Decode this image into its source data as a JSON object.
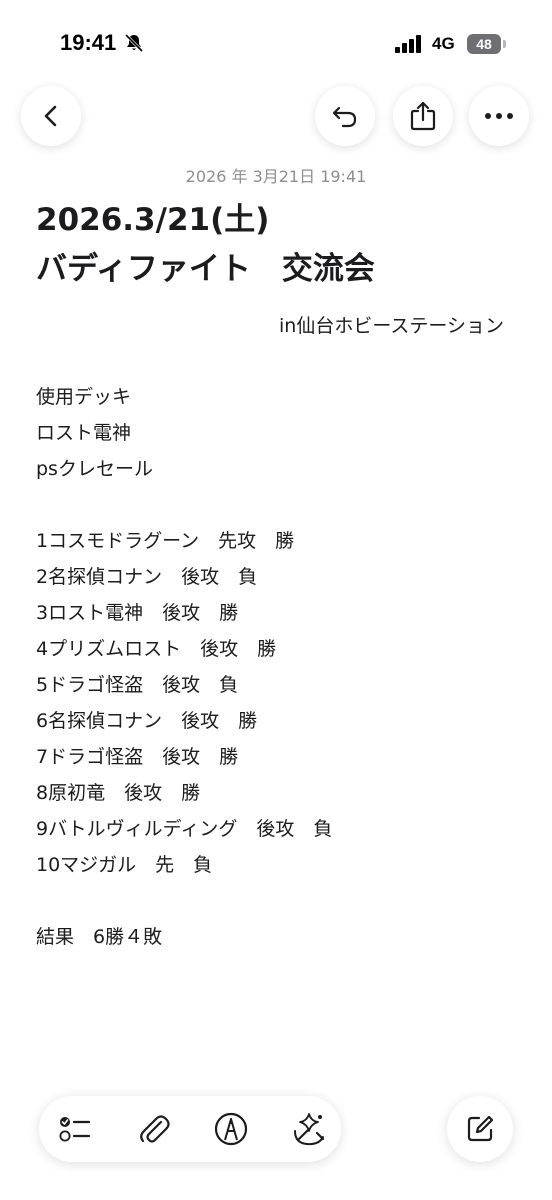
{
  "status_bar": {
    "time": "19:41",
    "network": "4G",
    "battery": "48"
  },
  "note": {
    "date": "2026 年 3月21日 19:41",
    "title_lines": [
      "2026.3/21(土)",
      "バディファイト　交流会"
    ],
    "location": "in仙台ホビーステーション",
    "deck_lines": [
      "使用デッキ",
      "ロスト電神",
      "psクレセール"
    ],
    "match_lines": [
      "1コスモドラグーン　先攻　勝",
      "2名探偵コナン　後攻　負",
      "3ロスト電神　後攻　勝",
      "4プリズムロスト　後攻　勝",
      "5ドラゴ怪盗　後攻　負",
      "6名探偵コナン　後攻　勝",
      "7ドラゴ怪盗　後攻　勝",
      "8原初竜　後攻　勝",
      "9バトルヴィルディング　後攻　負",
      "10マジガル　先　負"
    ],
    "result": "結果　6勝４敗"
  },
  "icons": {
    "top_toolbar": [
      "back-icon",
      "undo-icon",
      "share-icon",
      "more-icon"
    ],
    "bottom_toolbar": [
      "checklist-icon",
      "paperclip-icon",
      "markup-pen-icon",
      "apple-intelligence-icon",
      "compose-icon"
    ]
  }
}
